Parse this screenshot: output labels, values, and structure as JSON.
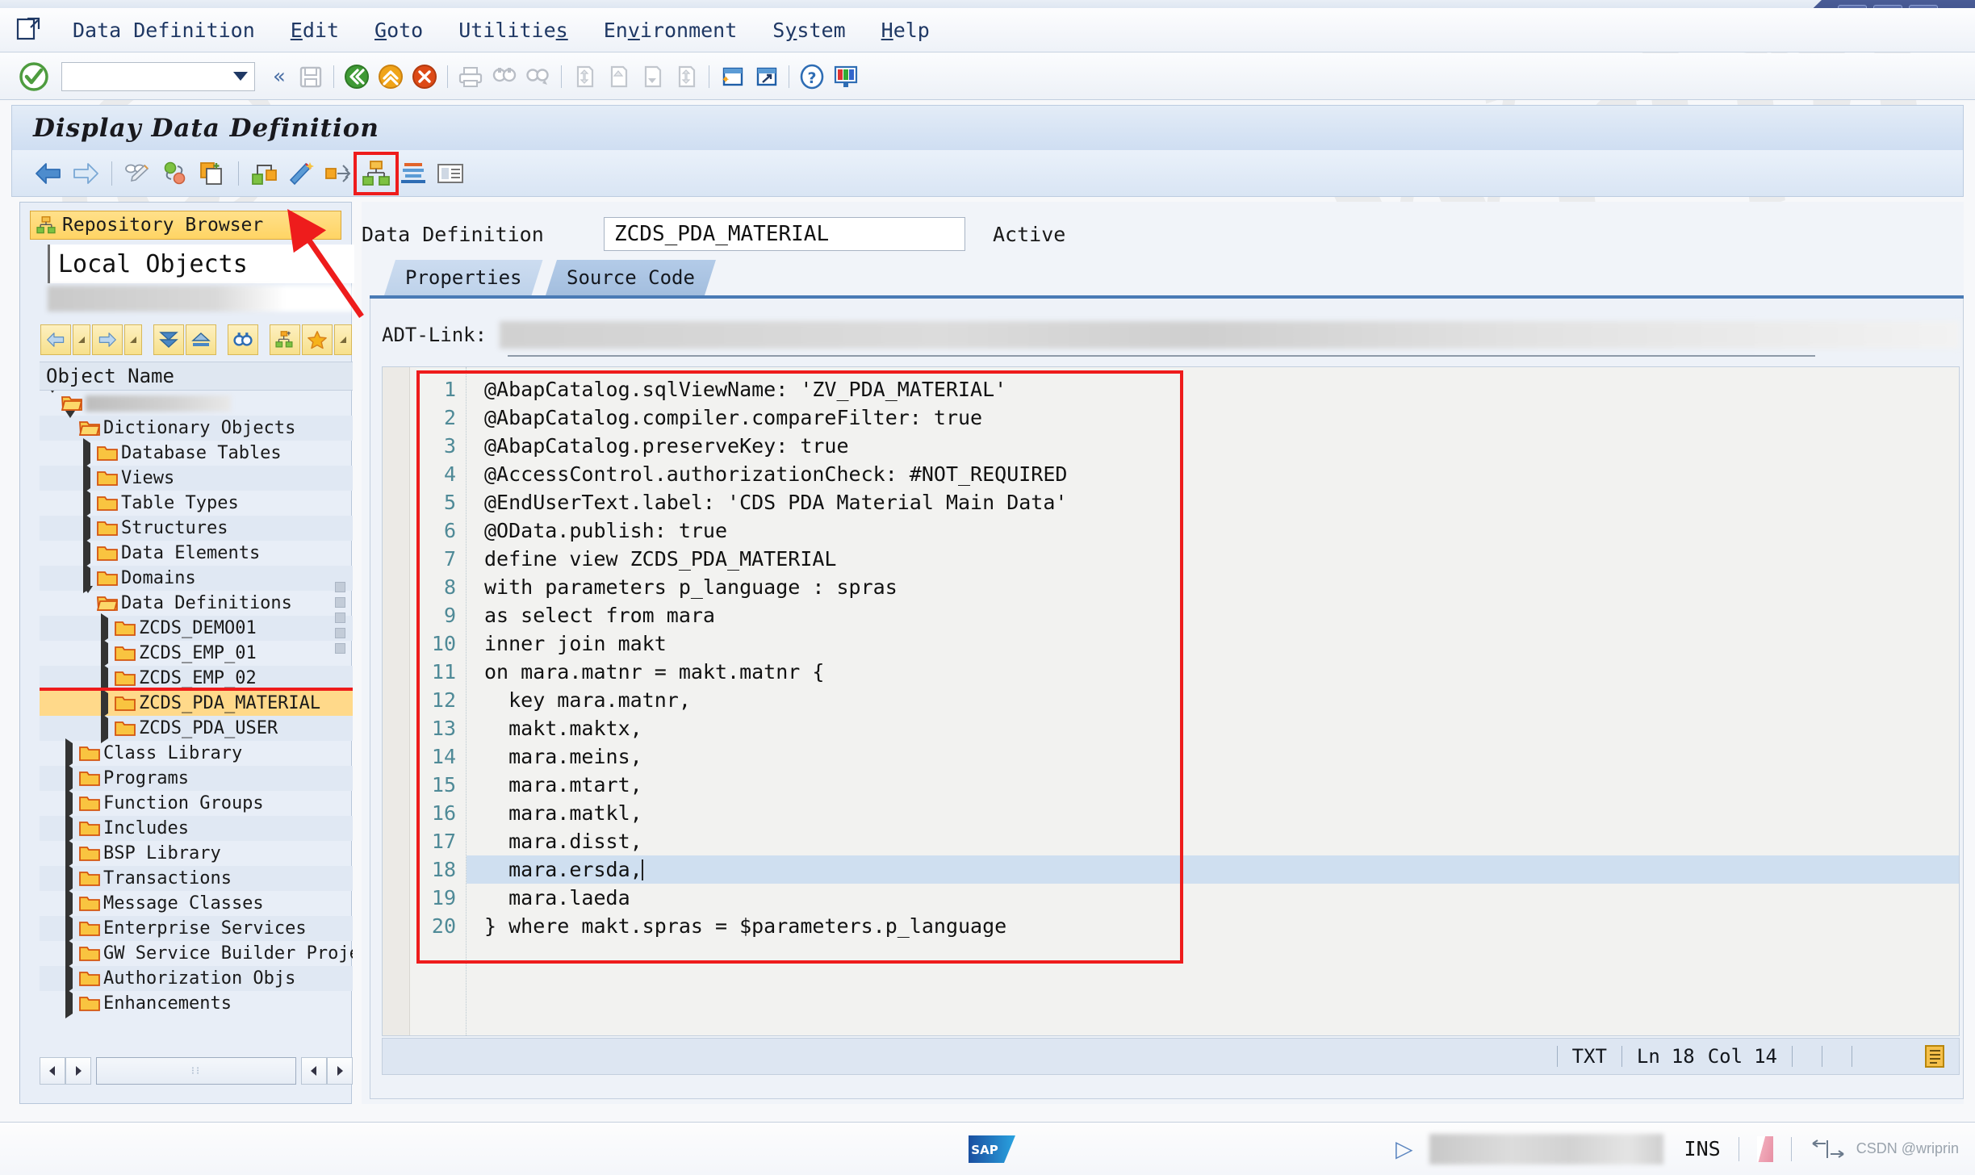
{
  "window": {
    "controls": [
      {
        "name": "minimize",
        "glyph": "—"
      },
      {
        "name": "restore",
        "glyph": "❐"
      },
      {
        "name": "close",
        "glyph": "✕"
      }
    ]
  },
  "menubar": {
    "system_icon": "sap-system-menu-icon",
    "items": [
      {
        "label": "Data Definition",
        "accel": ""
      },
      {
        "label": "Edit",
        "accel": "E"
      },
      {
        "label": "Goto",
        "accel": "G"
      },
      {
        "label": "Utilities",
        "accel": "s"
      },
      {
        "label": "Environment",
        "accel": "v"
      },
      {
        "label": "System",
        "accel": "y"
      },
      {
        "label": "Help",
        "accel": "H"
      }
    ]
  },
  "system_toolbar": {
    "command_field_value": "",
    "command_field_placeholder": "",
    "ok_icon": "green-check-icon",
    "dropdown_icon": "chevron-down-icon",
    "collapse_icon": "«",
    "buttons": [
      "save-icon",
      "back-icon",
      "exit-icon",
      "cancel-icon",
      "print-icon",
      "find-icon",
      "find-next-icon",
      "first-page-icon",
      "previous-page-icon",
      "next-page-icon",
      "last-page-icon",
      "create-session-icon",
      "create-shortcut-icon",
      "help-icon",
      "customize-layout-icon"
    ]
  },
  "screen": {
    "title": "Display Data Definition"
  },
  "app_toolbar": {
    "buttons": [
      {
        "name": "back-arrow-icon",
        "highlighted": false
      },
      {
        "name": "forward-arrow-icon",
        "highlighted": false
      },
      {
        "name": "check-syntax-icon",
        "highlighted": false
      },
      {
        "name": "activate-icon",
        "highlighted": false
      },
      {
        "name": "copy-object-icon",
        "highlighted": false
      },
      {
        "name": "where-used-list-icon",
        "highlighted": false
      },
      {
        "name": "generate-icon",
        "highlighted": false
      },
      {
        "name": "relationships-icon",
        "highlighted": false
      },
      {
        "name": "repository-browser-icon",
        "highlighted": true
      },
      {
        "name": "sort-icon",
        "highlighted": false
      },
      {
        "name": "details-icon",
        "highlighted": false
      }
    ]
  },
  "sidebar": {
    "header": {
      "label": "Repository Browser",
      "icon": "repository-browser-icon"
    },
    "object_selector_value": "Local Objects",
    "toolbar_buttons": [
      "back-icon",
      "back-dropdown-icon",
      "forward-icon",
      "forward-dropdown-icon",
      "expand-all-icon",
      "collapse-all-icon",
      "find-icon",
      "object-list-icon",
      "favorites-icon",
      "favorites-dropdown-icon",
      "more-icon"
    ],
    "column_header": "Object Name",
    "tree": [
      {
        "label": "",
        "depth": 0,
        "state": "expanded",
        "icon": "folder-open-icon",
        "blurred": true,
        "selected": false
      },
      {
        "label": "Dictionary Objects",
        "depth": 1,
        "state": "expanded",
        "icon": "folder-open-icon",
        "blurred": false,
        "selected": false
      },
      {
        "label": "Database Tables",
        "depth": 2,
        "state": "collapsed",
        "icon": "folder-icon",
        "blurred": false,
        "selected": false
      },
      {
        "label": "Views",
        "depth": 2,
        "state": "collapsed",
        "icon": "folder-icon",
        "blurred": false,
        "selected": false
      },
      {
        "label": "Table Types",
        "depth": 2,
        "state": "collapsed",
        "icon": "folder-icon",
        "blurred": false,
        "selected": false
      },
      {
        "label": "Structures",
        "depth": 2,
        "state": "collapsed",
        "icon": "folder-icon",
        "blurred": false,
        "selected": false
      },
      {
        "label": "Data Elements",
        "depth": 2,
        "state": "collapsed",
        "icon": "folder-icon",
        "blurred": false,
        "selected": false
      },
      {
        "label": "Domains",
        "depth": 2,
        "state": "collapsed",
        "icon": "folder-icon",
        "blurred": false,
        "selected": false
      },
      {
        "label": "Data Definitions",
        "depth": 2,
        "state": "expanded",
        "icon": "folder-open-icon",
        "blurred": false,
        "selected": false
      },
      {
        "label": "ZCDS_DEMO01",
        "depth": 3,
        "state": "collapsed",
        "icon": "folder-icon",
        "blurred": false,
        "selected": false
      },
      {
        "label": "ZCDS_EMP_01",
        "depth": 3,
        "state": "collapsed",
        "icon": "folder-icon",
        "blurred": false,
        "selected": false
      },
      {
        "label": "ZCDS_EMP_02",
        "depth": 3,
        "state": "collapsed",
        "icon": "folder-icon",
        "blurred": false,
        "selected": false
      },
      {
        "label": "ZCDS_PDA_MATERIAL",
        "depth": 3,
        "state": "collapsed",
        "icon": "folder-icon",
        "blurred": false,
        "selected": true
      },
      {
        "label": "ZCDS_PDA_USER",
        "depth": 3,
        "state": "collapsed",
        "icon": "folder-icon",
        "blurred": false,
        "selected": false
      },
      {
        "label": "Class Library",
        "depth": 1,
        "state": "collapsed",
        "icon": "folder-icon",
        "blurred": false,
        "selected": false
      },
      {
        "label": "Programs",
        "depth": 1,
        "state": "collapsed",
        "icon": "folder-icon",
        "blurred": false,
        "selected": false
      },
      {
        "label": "Function Groups",
        "depth": 1,
        "state": "collapsed",
        "icon": "folder-icon",
        "blurred": false,
        "selected": false
      },
      {
        "label": "Includes",
        "depth": 1,
        "state": "collapsed",
        "icon": "folder-icon",
        "blurred": false,
        "selected": false
      },
      {
        "label": "BSP Library",
        "depth": 1,
        "state": "collapsed",
        "icon": "folder-icon",
        "blurred": false,
        "selected": false
      },
      {
        "label": "Transactions",
        "depth": 1,
        "state": "collapsed",
        "icon": "folder-icon",
        "blurred": false,
        "selected": false
      },
      {
        "label": "Message Classes",
        "depth": 1,
        "state": "collapsed",
        "icon": "folder-icon",
        "blurred": false,
        "selected": false
      },
      {
        "label": "Enterprise Services",
        "depth": 1,
        "state": "collapsed",
        "icon": "folder-icon",
        "blurred": false,
        "selected": false
      },
      {
        "label": "GW Service Builder Projects",
        "depth": 1,
        "state": "collapsed",
        "icon": "folder-icon",
        "blurred": false,
        "selected": false
      },
      {
        "label": "Authorization Objs",
        "depth": 1,
        "state": "collapsed",
        "icon": "folder-icon",
        "blurred": false,
        "selected": false
      },
      {
        "label": "Enhancements",
        "depth": 1,
        "state": "collapsed",
        "icon": "folder-icon",
        "blurred": false,
        "selected": false
      }
    ]
  },
  "main": {
    "data_definition_label": "Data Definition",
    "data_definition_name": "ZCDS_PDA_MATERIAL",
    "status": "Active",
    "tabs": [
      {
        "label": "Properties",
        "active": false
      },
      {
        "label": "Source Code",
        "active": true
      }
    ],
    "adt_link_label": "ADT-Link:",
    "adt_link_value": ""
  },
  "editor": {
    "lines": [
      {
        "n": "1",
        "text": "@AbapCatalog.sqlViewName: 'ZV_PDA_MATERIAL'"
      },
      {
        "n": "2",
        "text": "@AbapCatalog.compiler.compareFilter: true"
      },
      {
        "n": "3",
        "text": "@AbapCatalog.preserveKey: true"
      },
      {
        "n": "4",
        "text": "@AccessControl.authorizationCheck: #NOT_REQUIRED"
      },
      {
        "n": "5",
        "text": "@EndUserText.label: 'CDS PDA Material Main Data'"
      },
      {
        "n": "6",
        "text": "@OData.publish: true"
      },
      {
        "n": "7",
        "text": "define view ZCDS_PDA_MATERIAL"
      },
      {
        "n": "8",
        "text": "with parameters p_language : spras"
      },
      {
        "n": "9",
        "text": "as select from mara"
      },
      {
        "n": "10",
        "text": "inner join makt"
      },
      {
        "n": "11",
        "text": "on mara.matnr = makt.matnr {"
      },
      {
        "n": "12",
        "text": "  key mara.matnr,"
      },
      {
        "n": "13",
        "text": "  makt.maktx,"
      },
      {
        "n": "14",
        "text": "  mara.meins,"
      },
      {
        "n": "15",
        "text": "  mara.mtart,"
      },
      {
        "n": "16",
        "text": "  mara.matkl,"
      },
      {
        "n": "17",
        "text": "  mara.disst,"
      },
      {
        "n": "18",
        "text": "  mara.ersda,",
        "active": true,
        "caret": true
      },
      {
        "n": "19",
        "text": "  mara.laeda"
      },
      {
        "n": "20",
        "text": "} where makt.spras = $parameters.p_language"
      }
    ],
    "status": {
      "mode": "TXT",
      "line_label": "Ln",
      "line": "18",
      "col_label": "Col",
      "col": "14",
      "icon": "editor-list-icon"
    }
  },
  "statusbar": {
    "logo": "SAP",
    "play_icon": "expand-status-icon",
    "system_info": "",
    "insert_mode": "INS",
    "server_icon": "server-status-icon",
    "resize_icon": "resize-grip-icon"
  },
  "colors": {
    "accent_blue": "#4a7bb5",
    "highlight_red": "#ee1c1c",
    "selection_yellow": "#ffd98a",
    "gutter_teal": "#4f8a97",
    "active_line": "#cfdff0"
  },
  "watermarks": [
    "@Wriprin",
    "@W",
    "CSDN @wriprin"
  ]
}
